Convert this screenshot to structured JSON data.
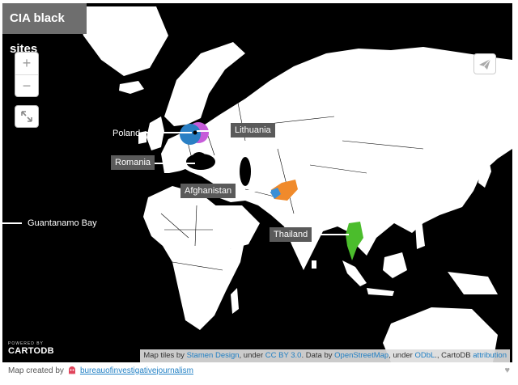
{
  "map": {
    "title": "CIA black sites",
    "zoom_in_label": "+",
    "zoom_out_label": "−",
    "fullscreen_icon": "expand-icon",
    "share_icon": "paper-plane-icon",
    "colors": {
      "ocean": "#000000",
      "land": "#ffffff",
      "poland": "#2a7fc4",
      "lithuania": "#c65bd9",
      "afghanistan": "#f08a2b",
      "afghanistan_alt": "#3b8fd6",
      "thailand": "#4bbd2c",
      "label_box": "#5a5a5a"
    },
    "sites": [
      {
        "name": "Poland",
        "boxed": true
      },
      {
        "name": "Lithuania",
        "boxed": true
      },
      {
        "name": "Romania",
        "boxed": true
      },
      {
        "name": "Afghanistan",
        "boxed": true
      },
      {
        "name": "Guantanamo Bay",
        "boxed": false
      },
      {
        "name": "Thailand",
        "boxed": true
      }
    ],
    "attribution": {
      "text1": "Map tiles by ",
      "link1": "Stamen Design",
      "text2": ", under ",
      "link2": "CC BY 3.0",
      "text3": ". Data by ",
      "link3": "OpenStreetMap",
      "text4": ", under ",
      "link4": "ODbL",
      "text5": "., CartoDB ",
      "link5": "attribution"
    },
    "logo_small": "POWERED BY",
    "logo": "CARTODB"
  },
  "footer": {
    "prefix": "Map created by",
    "author": "bureauofinvestigativejournalism",
    "author_icon": "ghost-avatar-icon",
    "like_icon": "heart-icon"
  }
}
